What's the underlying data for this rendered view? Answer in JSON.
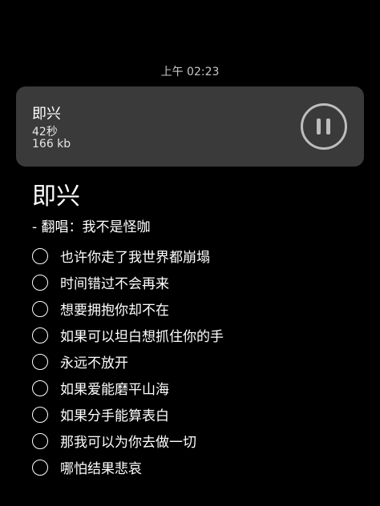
{
  "timestamp": "上午 02:23",
  "voice_message": {
    "title": "即兴",
    "duration": "42秒",
    "size": "166 kb",
    "control_icon": "pause-icon"
  },
  "song": {
    "title": "即兴",
    "singer_line": "-  翻唱：我不是怪咖"
  },
  "lyrics": [
    "也许你走了我世界都崩塌",
    "时间错过不会再来",
    "想要拥抱你却不在",
    "如果可以坦白想抓住你的手",
    "永远不放开",
    "如果爱能磨平山海",
    "如果分手能算表白",
    "那我可以为你去做一切",
    "哪怕结果悲哀"
  ],
  "colors": {
    "background": "#000000",
    "card": "#3a3a3a",
    "icon": "#bdbdbd",
    "text": "#ffffff"
  }
}
